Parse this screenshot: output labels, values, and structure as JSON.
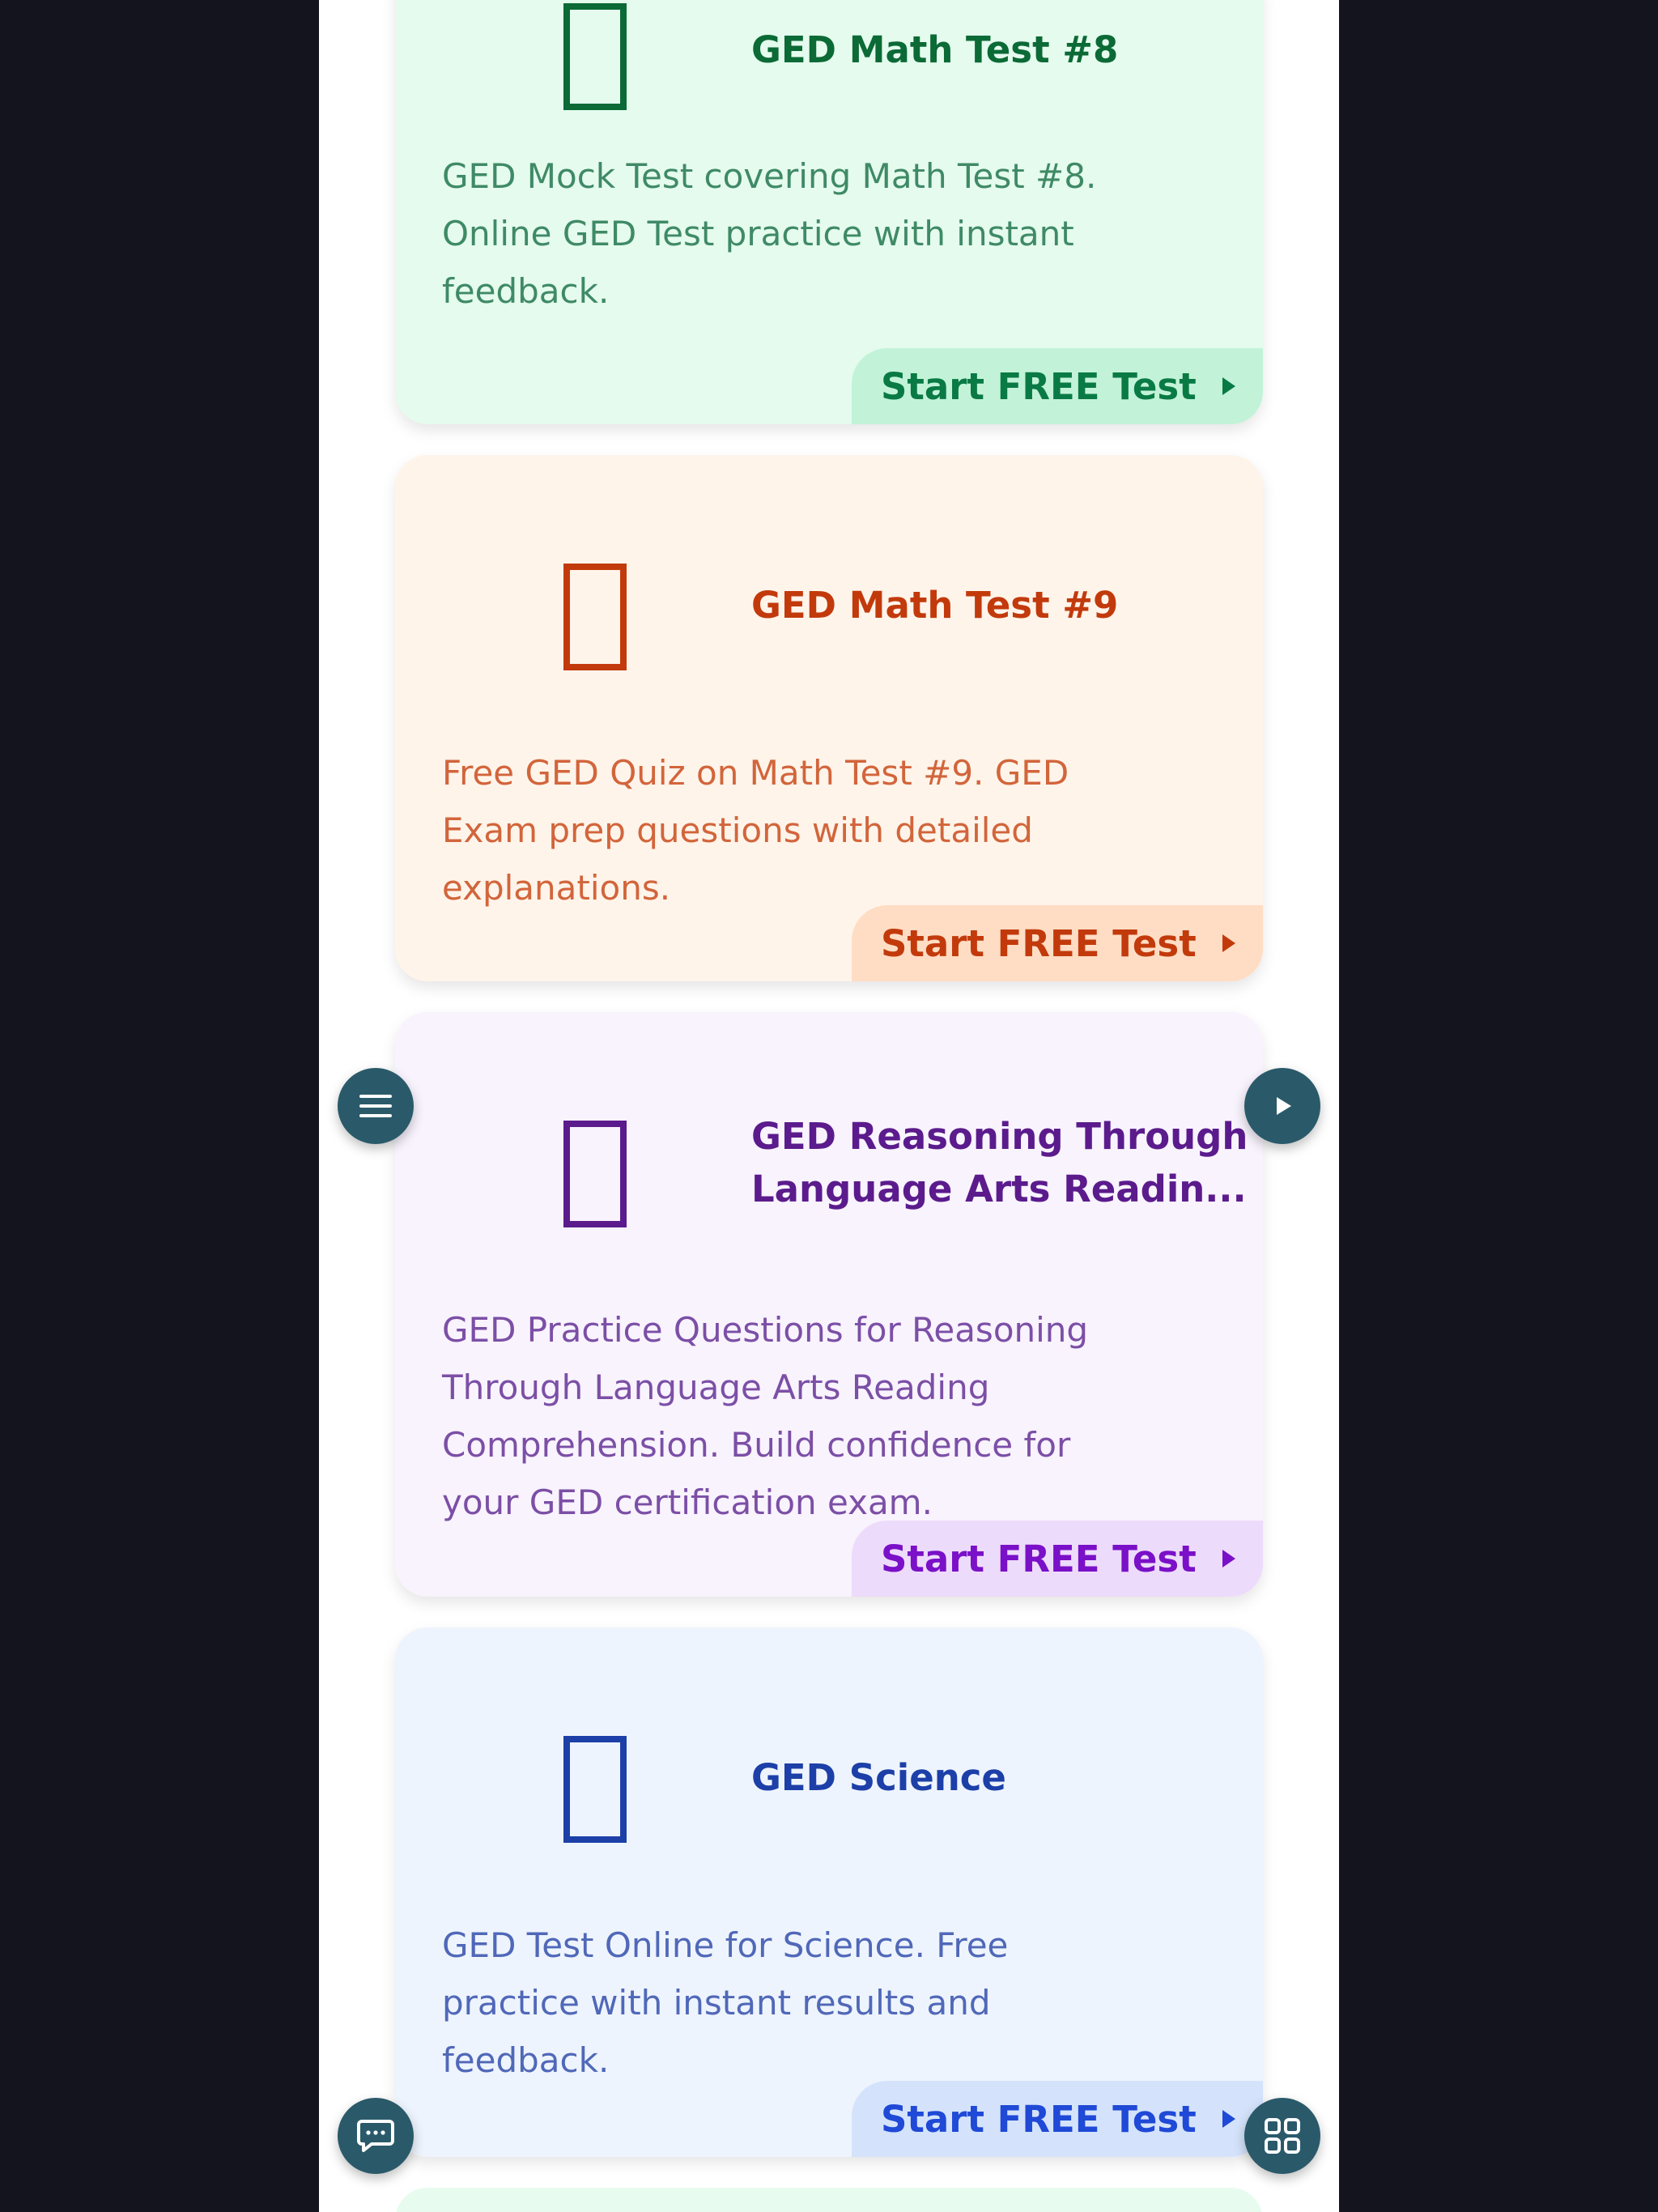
{
  "cards": [
    {
      "title": "GED Math Test #8",
      "description": "GED Mock Test covering Math Test #8. Online GED Test practice with instant feedback.",
      "cta": "Start FREE Test",
      "icon": "book-icon",
      "colors": {
        "bg": "#e5fbee",
        "title": "#0b6a35",
        "desc": "#3f8a66",
        "cta_bg": "#c2f3d8",
        "cta_text": "#0a7a45"
      }
    },
    {
      "title": "GED Math Test #9",
      "description": "Free GED Quiz on Math Test #9. GED Exam prep questions with detailed explanations.",
      "cta": "Start FREE Test",
      "icon": "book-icon",
      "colors": {
        "bg": "#fff4ea",
        "title": "#c23a0c",
        "desc": "#d2653b",
        "cta_bg": "#ffddc4",
        "cta_text": "#c23a0c"
      }
    },
    {
      "title": "GED Reasoning Through Language Arts Readin...",
      "description": "GED Practice Questions for Reasoning Through Language Arts Reading Comprehension. Build confidence for your GED certification exam.",
      "cta": "Start FREE Test",
      "icon": "book-icon",
      "colors": {
        "bg": "#f8f3fd",
        "title": "#5b1b8c",
        "desc": "#7c4fa6",
        "cta_bg": "#eddbfb",
        "cta_text": "#7a10c7"
      }
    },
    {
      "title": "GED Science",
      "description": "GED Test Online for Science. Free practice with instant results and feedback.",
      "cta": "Start FREE Test",
      "icon": "book-icon",
      "colors": {
        "bg": "#eef4fd",
        "title": "#1c3fa8",
        "desc": "#5068b8",
        "cta_bg": "#d4e3fb",
        "cta_text": "#1f49d6"
      }
    }
  ],
  "fabs": {
    "menu": "menu-icon",
    "play": "play-icon",
    "chat": "chat-icon",
    "grid": "grid-icon"
  }
}
